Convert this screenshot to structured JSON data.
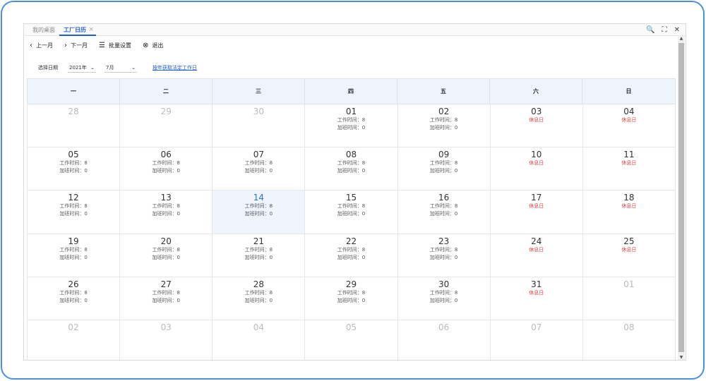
{
  "tabs": [
    {
      "label": "我的桌面"
    },
    {
      "label": "工厂日历",
      "close": "×"
    }
  ],
  "window_icons": {
    "search": "🔍",
    "fullscreen": "⛶",
    "close": "✕"
  },
  "toolbar": {
    "prev_label": "上一月",
    "next_label": "下一月",
    "batch_label": "批量设置",
    "exit_label": "退出"
  },
  "filter": {
    "label": "选择日期",
    "year": "2021年",
    "month": "7月",
    "link": "按年获取法定工作日"
  },
  "weekdays": [
    "一",
    "二",
    "三",
    "四",
    "五",
    "六",
    "日"
  ],
  "work_prefix": "工作时间：",
  "ot_prefix": "加班时间：",
  "rest_label": "休息日",
  "days": [
    {
      "n": "28",
      "muted": true
    },
    {
      "n": "29",
      "muted": true
    },
    {
      "n": "30",
      "muted": true
    },
    {
      "n": "01",
      "w": "8",
      "o": "0"
    },
    {
      "n": "02",
      "w": "8",
      "o": "0"
    },
    {
      "n": "03",
      "rest": true
    },
    {
      "n": "04",
      "rest": true
    },
    {
      "n": "05",
      "w": "8",
      "o": "0"
    },
    {
      "n": "06",
      "w": "8",
      "o": "0"
    },
    {
      "n": "07",
      "w": "8",
      "o": "0"
    },
    {
      "n": "08",
      "w": "8",
      "o": "0"
    },
    {
      "n": "09",
      "w": "8",
      "o": "0"
    },
    {
      "n": "10",
      "rest": true
    },
    {
      "n": "11",
      "rest": true
    },
    {
      "n": "12",
      "w": "8",
      "o": "0"
    },
    {
      "n": "13",
      "w": "8",
      "o": "0"
    },
    {
      "n": "14",
      "w": "8",
      "o": "0",
      "today": true
    },
    {
      "n": "15",
      "w": "8",
      "o": "0"
    },
    {
      "n": "16",
      "w": "8",
      "o": "0"
    },
    {
      "n": "17",
      "rest": true
    },
    {
      "n": "18",
      "rest": true
    },
    {
      "n": "19",
      "w": "8",
      "o": "0"
    },
    {
      "n": "20",
      "w": "8",
      "o": "0"
    },
    {
      "n": "21",
      "w": "8",
      "o": "0"
    },
    {
      "n": "22",
      "w": "8",
      "o": "0"
    },
    {
      "n": "23",
      "w": "8",
      "o": "0"
    },
    {
      "n": "24",
      "rest": true
    },
    {
      "n": "25",
      "rest": true
    },
    {
      "n": "26",
      "w": "8",
      "o": "0"
    },
    {
      "n": "27",
      "w": "8",
      "o": "0"
    },
    {
      "n": "28",
      "w": "8",
      "o": "0"
    },
    {
      "n": "29",
      "w": "8",
      "o": "0"
    },
    {
      "n": "30",
      "w": "8",
      "o": "0"
    },
    {
      "n": "31",
      "rest": true
    },
    {
      "n": "01",
      "muted": true
    },
    {
      "n": "02",
      "muted": true
    },
    {
      "n": "03",
      "muted": true
    },
    {
      "n": "04",
      "muted": true
    },
    {
      "n": "05",
      "muted": true
    },
    {
      "n": "06",
      "muted": true
    },
    {
      "n": "07",
      "muted": true
    },
    {
      "n": "08",
      "muted": true
    }
  ],
  "colors": {
    "accent": "#1e5bd6",
    "rest": "#e0403d",
    "today_bg": "#eef5fd",
    "header_bg": "#eef4fc"
  }
}
